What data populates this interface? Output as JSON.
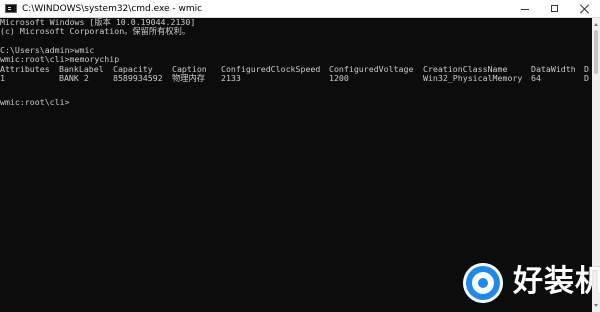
{
  "window": {
    "title": "C:\\WINDOWS\\system32\\cmd.exe - wmic"
  },
  "title_buttons": {
    "minimize_icon": "minimize-icon",
    "maximize_icon": "maximize-icon",
    "close_icon": "close-icon"
  },
  "console": {
    "lines": [
      "Microsoft Windows [版本 10.0.19044.2130]",
      "(c) Microsoft Corporation。保留所有权利。",
      "",
      "C:\\Users\\admin>wmic",
      "wmic:root\\cli>memorychip"
    ],
    "table_headers": [
      "Attributes",
      "BankLabel",
      "Capacity",
      "Caption",
      "ConfiguredClockSpeed",
      "ConfiguredVoltage",
      "CreationClassName",
      "DataWidth",
      "D"
    ],
    "table_values": [
      "1",
      "BANK 2",
      "8589934592",
      "物理内存",
      "2133",
      "1200",
      "Win32_PhysicalMemory",
      "64",
      "D"
    ],
    "prompt": "wmic:root\\cli>"
  },
  "watermark": {
    "text": "好装机",
    "colors": {
      "blue": "#1d88ee",
      "white": "#ffffff"
    }
  },
  "colors": {
    "console_background": "#0c0c0c",
    "console_text": "#cccccc",
    "titlebar_background": "#ffffff",
    "scrollbar_background": "#f0f0f0"
  }
}
